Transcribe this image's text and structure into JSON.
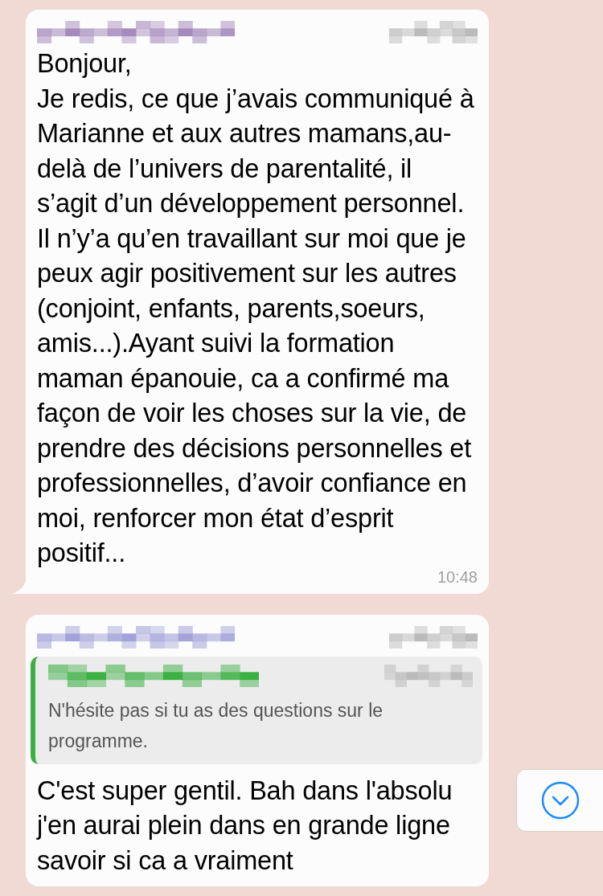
{
  "messages": [
    {
      "color": "#a58bbd",
      "text": "Bonjour,\nJe redis, ce que j’avais communiqué à Marianne et aux autres mamans,au-delà de l’univers de parentalité, il s’agit d’un développement personnel. Il n’y’a qu’en travaillant sur moi que je peux agir positivement sur les autres (conjoint, enfants, parents,soeurs, amis...).Ayant suivi la formation maman épanouie, ca a confirmé ma façon de voir les choses sur la vie, de prendre des décisions personnelles et professionnelles, d’avoir confiance en moi, renforcer mon état d’esprit positif...",
      "time": "10:48",
      "tail": true
    },
    {
      "color": "#a3a3d9",
      "quote": {
        "color": "#3cb043",
        "text": "N'hésite pas si tu as des questions sur le programme."
      },
      "text": "C'est super gentil. Bah dans l'absolu j'en aurai plein dans en grande ligne savoir si ca a vraiment",
      "tail": false
    }
  ]
}
